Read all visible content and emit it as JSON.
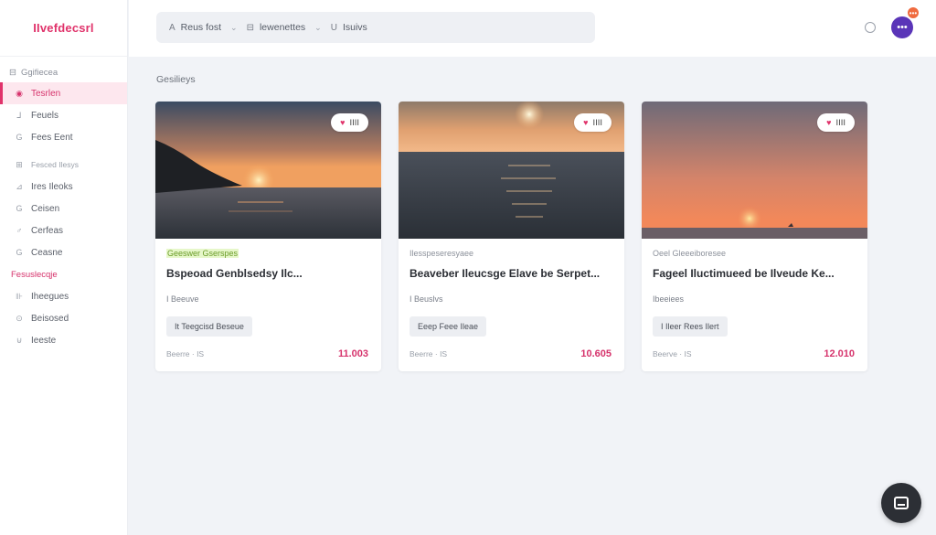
{
  "app": {
    "brand": "IIvefdecsrl"
  },
  "topbar": {
    "crumbs": [
      {
        "label": "Reus fost",
        "icon": "A"
      },
      {
        "label": "lewenettes",
        "icon": "⊟"
      },
      {
        "label": "Isuivs",
        "icon": "U"
      }
    ],
    "separator": "⌄",
    "avatar_glyph": "•••",
    "notification_glyph": "•••"
  },
  "sidebar": {
    "header": "Ggifiecea",
    "items": [
      {
        "label": "Tesrlen",
        "icon": "◉",
        "active": true
      },
      {
        "label": "Feuels",
        "icon": "⅃"
      },
      {
        "label": "Fees Eent",
        "icon": "G"
      },
      {
        "label": "Fesced Ilesys",
        "icon": "⊞",
        "small": true
      },
      {
        "label": "Ires Ileoks",
        "icon": "⊿"
      },
      {
        "label": "Ceisen",
        "icon": "G"
      },
      {
        "label": "Cerfeas",
        "icon": "♂"
      },
      {
        "label": "Ceasne",
        "icon": "G"
      }
    ],
    "group_label": "Fesuslecqje",
    "group_items": [
      {
        "label": "Iheegues",
        "icon": "⊪"
      },
      {
        "label": "Beisosed",
        "icon": "⊙"
      },
      {
        "label": "Ieeste",
        "icon": "⊍"
      }
    ]
  },
  "main": {
    "title": "Gesilieys",
    "cards": [
      {
        "rating": "IIII",
        "category": "Geeswer Gserspes",
        "category_highlight": true,
        "title": "Bspeoad Genblsedsy Ilc...",
        "sub": "I Beeuve",
        "tag": "It Teegcisd Beseue",
        "meta": "Beerre · IS",
        "price": "11.003"
      },
      {
        "rating": "IIII",
        "category": "Ilesspeseresyaee",
        "category_highlight": false,
        "title": "Beaveber Ileucsge Elave be Serpet...",
        "sub": "I Beuslvs",
        "tag": "Eeep Feee Ileae",
        "meta": "Beerre · IS",
        "price": "10.605"
      },
      {
        "rating": "IIII",
        "category": "Oeel Gleeeiboresee",
        "category_highlight": false,
        "title": "Fageel Iluctimueed be Ilveude Ke...",
        "sub": "Ibeeiees",
        "tag": "I Ileer Rees Ilert",
        "meta": "Beerve · IS",
        "price": "12.010"
      }
    ]
  }
}
